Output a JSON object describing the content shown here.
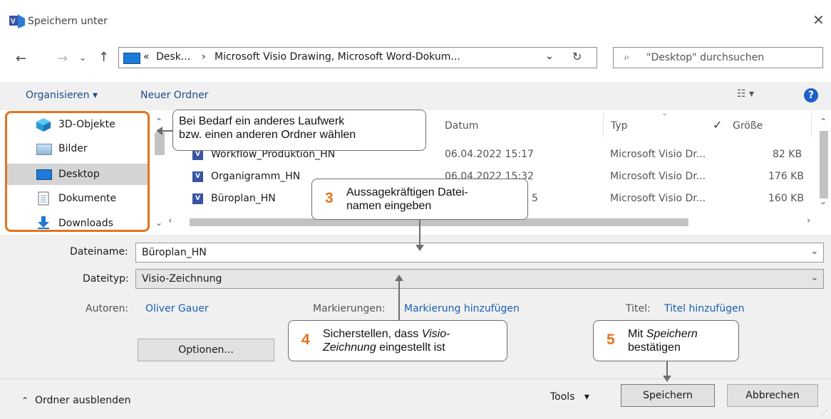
{
  "window": {
    "title": "Speichern unter"
  },
  "address": {
    "chevron": "«",
    "crumb1": "Desk...",
    "sep": "›",
    "crumb2": "Microsoft Visio Drawing, Microsoft Word-Dokum...",
    "search_placeholder": "\"Desktop\" durchsuchen"
  },
  "toolbar": {
    "organize_label": "Organisieren",
    "new_folder_label": "Neuer Ordner"
  },
  "nav": {
    "items": [
      {
        "label": "3D-Objekte",
        "icon": "cube-icon"
      },
      {
        "label": "Bilder",
        "icon": "pictures-icon"
      },
      {
        "label": "Desktop",
        "icon": "desktop-icon",
        "selected": true
      },
      {
        "label": "Dokumente",
        "icon": "documents-icon"
      },
      {
        "label": "Downloads",
        "icon": "downloads-icon"
      }
    ]
  },
  "files": {
    "headers": {
      "date": "Datum",
      "type": "Typ",
      "size": "Größe"
    },
    "rows": [
      {
        "name": "Workflow_Produktion_HN",
        "date": "06.04.2022 15:17",
        "type": "Microsoft Visio Dr...",
        "size": "82 KB"
      },
      {
        "name": "Organigramm_HN",
        "date": "06.04.2022 15:32",
        "type": "Microsoft Visio Dr...",
        "size": "176 KB"
      },
      {
        "name": "Büroplan_HN",
        "date": "5",
        "type": "Microsoft Visio Dr...",
        "size": "160 KB"
      }
    ]
  },
  "form": {
    "filename_label": "Dateiname:",
    "filename_value": "Büroplan_HN",
    "filetype_label": "Dateityp:",
    "filetype_value": "Visio-Zeichnung",
    "authors_label": "Autoren:",
    "authors_value": "Oliver Gauer",
    "tags_label": "Markierungen:",
    "tags_value": "Markierung hinzufügen",
    "title_label": "Titel:",
    "title_value": "Titel hinzufügen",
    "options_label": "Optionen..."
  },
  "footer": {
    "hide_folders": "Ordner ausblenden",
    "tools": "Tools",
    "save": "Speichern",
    "cancel": "Abbrechen"
  },
  "callouts": {
    "c1_line1": "Bei Bedarf ein anderes Laufwerk",
    "c1_line2": "bzw. einen anderen Ordner wählen",
    "c3_num": "3",
    "c3_line1": "Aussagekräftigen Datei-",
    "c3_line2": "namen eingeben",
    "c4_num": "4",
    "c4_line1": "Sicherstellen, dass ",
    "c4_line1_italic": "Visio-",
    "c4_line2_italic": "Zeichnung",
    "c4_line2": " eingestellt ist",
    "c5_num": "5",
    "c5_line1": "Mit ",
    "c5_line1_italic": "Speichern",
    "c5_line2": "bestätigen"
  },
  "colors": {
    "accent_orange": "#e4731f",
    "link_blue": "#1a5fb4",
    "help_blue": "#1f5fc9"
  }
}
